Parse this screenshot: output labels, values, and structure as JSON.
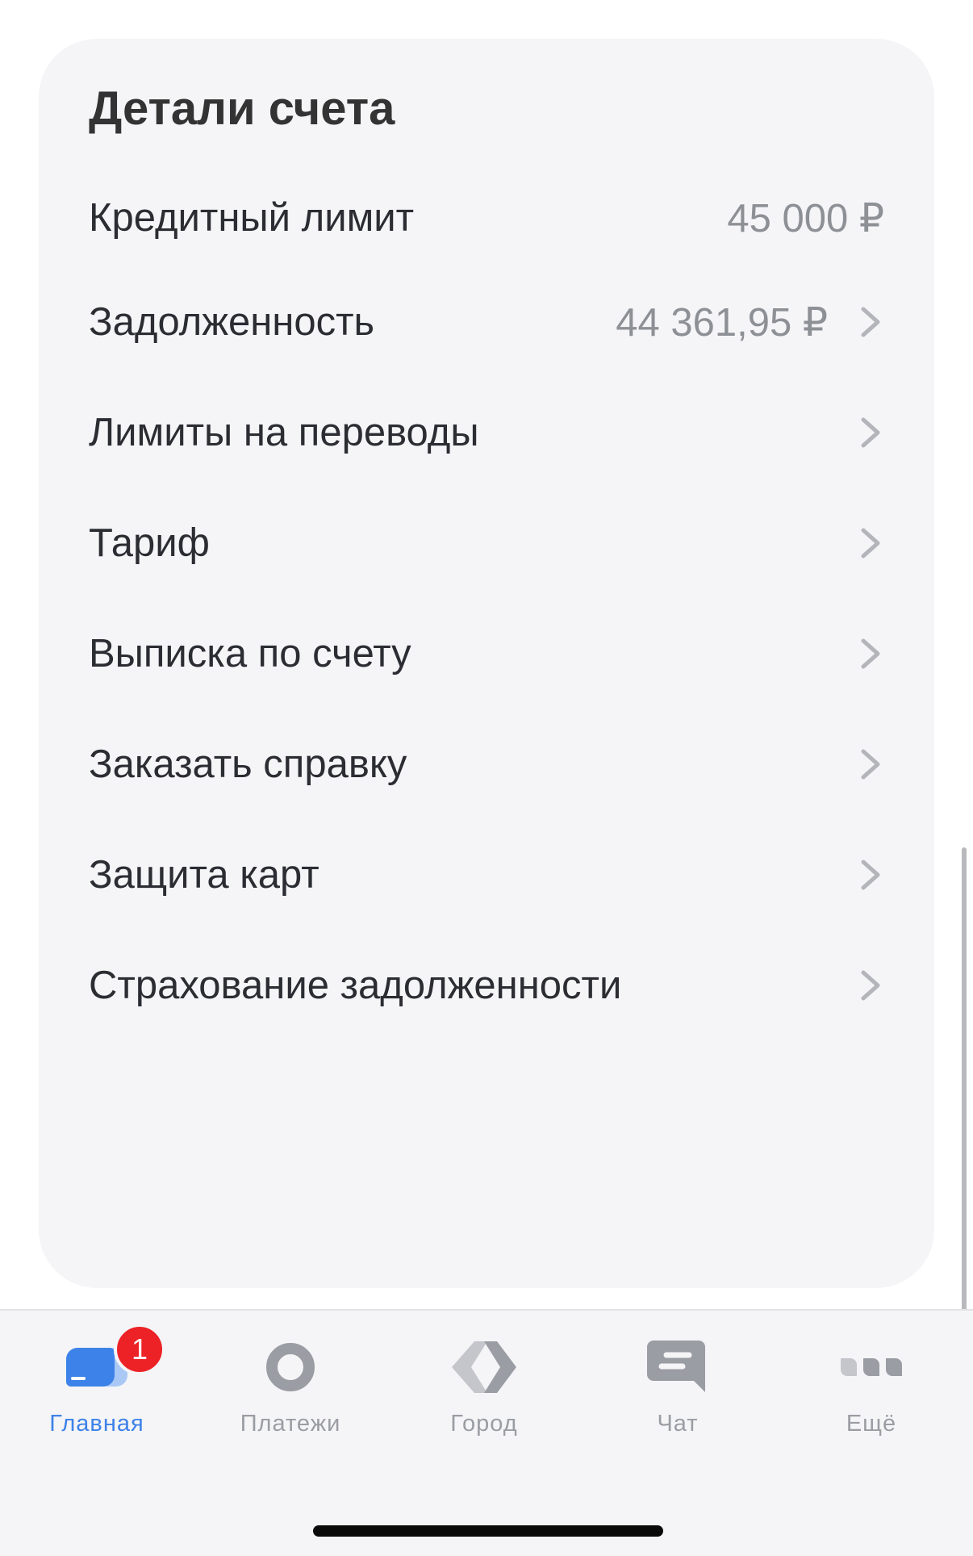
{
  "account_details": {
    "title": "Детали счета",
    "rows": [
      {
        "label": "Кредитный лимит",
        "value": "45 000 ₽"
      },
      {
        "label": "Задолженность",
        "value": "44 361,95 ₽"
      },
      {
        "label": "Лимиты на переводы"
      },
      {
        "label": "Тариф"
      },
      {
        "label": "Выписка по счету"
      },
      {
        "label": "Заказать справку"
      },
      {
        "label": "Защита карт"
      },
      {
        "label": "Страхование задолженности"
      }
    ]
  },
  "tabbar": {
    "tabs": [
      {
        "label": "Главная",
        "icon": "home-icon",
        "active": true,
        "badge": "1"
      },
      {
        "label": "Платежи",
        "icon": "payments-icon"
      },
      {
        "label": "Город",
        "icon": "city-icon"
      },
      {
        "label": "Чат",
        "icon": "chat-icon"
      },
      {
        "label": "Ещё",
        "icon": "more-icon"
      }
    ]
  },
  "colors": {
    "accent": "#3d82e8",
    "badge": "#ec2227",
    "card_background": "#f5f5f7",
    "text_primary": "#2b2d33",
    "text_secondary": "#8d9095"
  }
}
